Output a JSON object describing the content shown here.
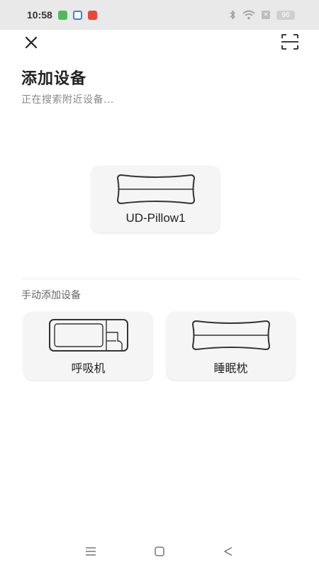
{
  "status_bar": {
    "time": "10:58",
    "app_icons": [
      {
        "name": "green-app-icon",
        "color": "#4cbb5a"
      },
      {
        "name": "blue-app-icon",
        "color": "#3a7ee8"
      },
      {
        "name": "red-app-icon",
        "color": "#e8473a"
      }
    ],
    "battery": "96",
    "icons": [
      "bluetooth-icon",
      "wifi-icon",
      "sim-off-icon",
      "battery-icon"
    ]
  },
  "header": {
    "title": "添加设备",
    "subtitle": "正在搜索附近设备..."
  },
  "found_devices": [
    {
      "label": "UD-Pillow1",
      "icon": "pillow-icon"
    }
  ],
  "manual": {
    "section_label": "手动添加设备",
    "items": [
      {
        "label": "呼吸机",
        "icon": "ventilator-icon"
      },
      {
        "label": "睡眠枕",
        "icon": "pillow-icon"
      }
    ]
  },
  "colors": {
    "background": "#ffffff",
    "card": "#f5f5f5",
    "status_bar": "#e9e9e9",
    "text_primary": "#222222",
    "text_secondary": "#888888"
  }
}
